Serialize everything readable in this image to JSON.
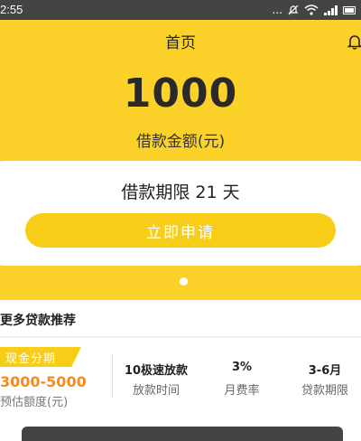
{
  "status_bar": {
    "time": "2:55",
    "dots": "..."
  },
  "header": {
    "title": "首页"
  },
  "loan": {
    "amount": "1000",
    "amount_label": "借款金额(元)",
    "term": "借款期限 21 天",
    "apply_button": "立即申请"
  },
  "section": {
    "title": "更多贷款推荐"
  },
  "product": {
    "tag": "现金分期",
    "range": "3000-5000",
    "range_label": "预估额度(元)",
    "stats": [
      {
        "value": "10极速放款",
        "label": "放款时间"
      },
      {
        "value": "3%",
        "label": "月费率"
      },
      {
        "value": "3-6月",
        "label": "贷款期限"
      }
    ]
  },
  "colors": {
    "primary": "#fcd22a",
    "button": "#f7cd18",
    "range": "#f58a1f",
    "status_bar": "#444446"
  }
}
